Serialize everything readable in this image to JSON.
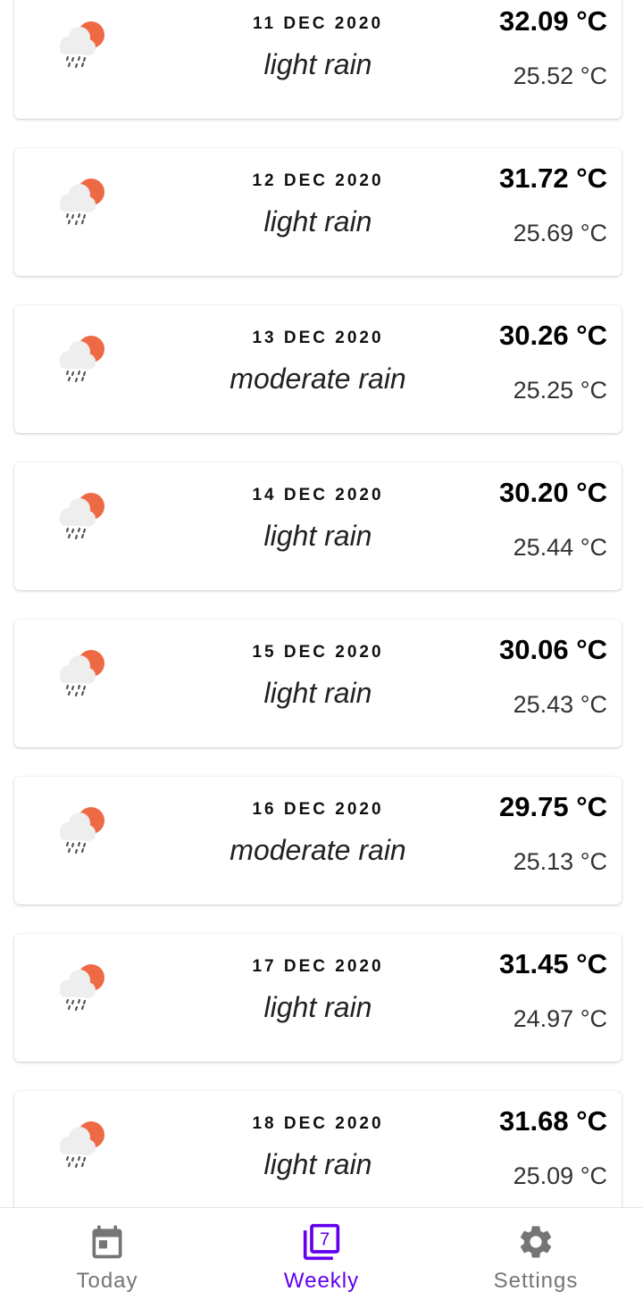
{
  "forecast": [
    {
      "date": "11 DEC 2020",
      "description": "light rain",
      "max": "32.09 °C",
      "min": "25.52 °C",
      "icon": "rain-cloud-sun-icon"
    },
    {
      "date": "12 DEC 2020",
      "description": "light rain",
      "max": "31.72 °C",
      "min": "25.69 °C",
      "icon": "rain-cloud-sun-icon"
    },
    {
      "date": "13 DEC 2020",
      "description": "moderate rain",
      "max": "30.26 °C",
      "min": "25.25 °C",
      "icon": "rain-cloud-sun-icon"
    },
    {
      "date": "14 DEC 2020",
      "description": "light rain",
      "max": "30.20 °C",
      "min": "25.44 °C",
      "icon": "rain-cloud-sun-icon"
    },
    {
      "date": "15 DEC 2020",
      "description": "light rain",
      "max": "30.06 °C",
      "min": "25.43 °C",
      "icon": "rain-cloud-sun-icon"
    },
    {
      "date": "16 DEC 2020",
      "description": "moderate rain",
      "max": "29.75 °C",
      "min": "25.13 °C",
      "icon": "rain-cloud-sun-icon"
    },
    {
      "date": "17 DEC 2020",
      "description": "light rain",
      "max": "31.45 °C",
      "min": "24.97 °C",
      "icon": "rain-cloud-sun-icon"
    },
    {
      "date": "18 DEC 2020",
      "description": "light rain",
      "max": "31.68 °C",
      "min": "25.09 °C",
      "icon": "rain-cloud-sun-icon"
    }
  ],
  "nav": {
    "items": [
      {
        "label": "Today",
        "icon": "calendar-icon",
        "active": false
      },
      {
        "label": "Weekly",
        "icon": "filter-7-icon",
        "active": true,
        "icon_text": "7"
      },
      {
        "label": "Settings",
        "icon": "gear-icon",
        "active": false
      }
    ]
  },
  "colors": {
    "accent": "#6200ee",
    "inactive": "#757575",
    "sun": "#ee6a45",
    "cloud": "#eeeeee"
  }
}
